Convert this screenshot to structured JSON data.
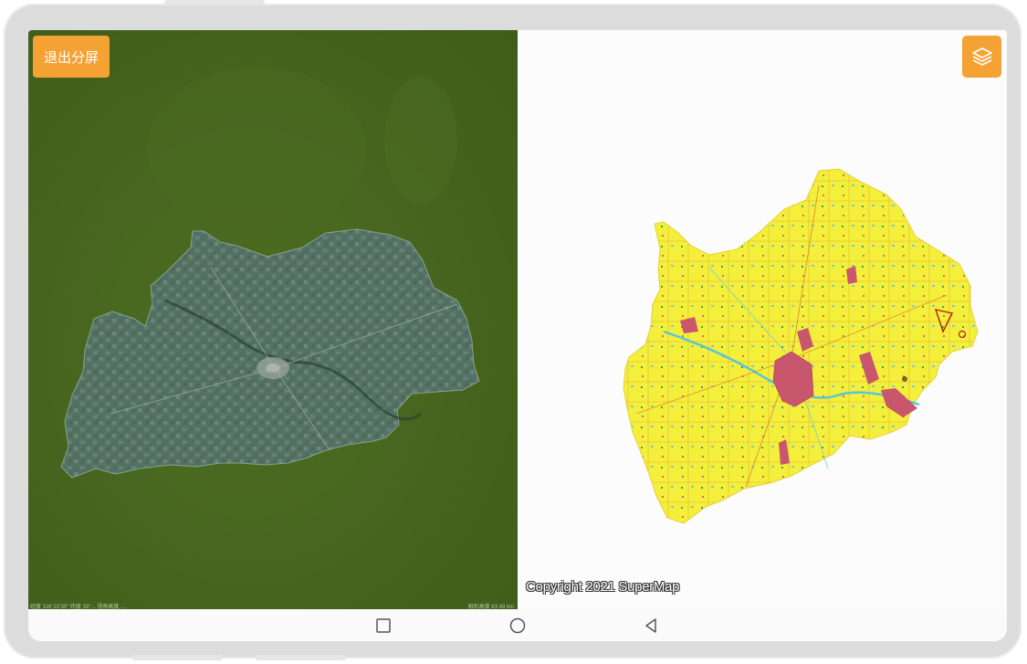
{
  "left_pane": {
    "exit_split_label": "退出分屏",
    "status_left": "经度 116°22'30\"  纬度 33°...   视角高度 ...",
    "status_right": "相机高度 63.49 km"
  },
  "right_pane": {
    "layers_icon": "layers-icon",
    "copyright": "Copyright 2021 SuperMap"
  },
  "navbar": {
    "recents_icon": "square-icon",
    "home_icon": "circle-icon",
    "back_icon": "triangle-back-icon"
  },
  "colors": {
    "accent": "#f5a235",
    "satellite_bg": "#48661f",
    "map_landuse": "#f4ef3a",
    "map_urban": "#c8566c"
  }
}
